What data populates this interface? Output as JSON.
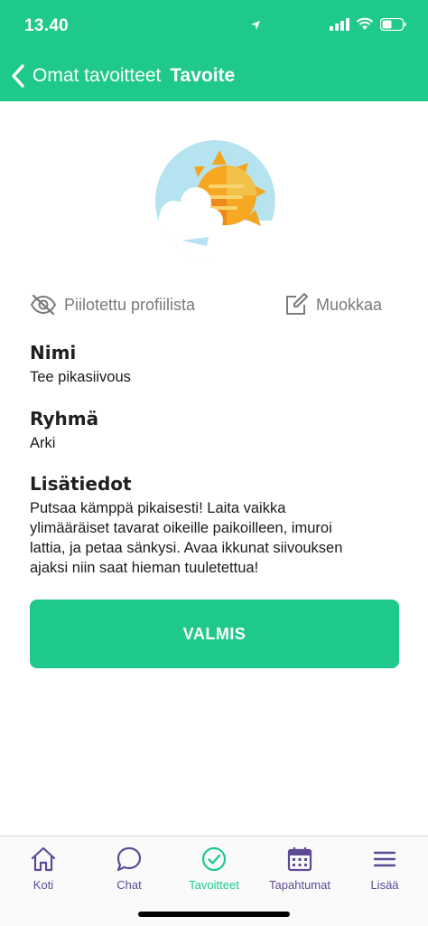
{
  "status": {
    "time": "13.40"
  },
  "nav": {
    "back_label": "Omat tavoitteet",
    "title": "Tavoite"
  },
  "actions": {
    "hidden_label": "Piilotettu profiilista",
    "edit_label": "Muokkaa"
  },
  "fields": {
    "name": {
      "label": "Nimi",
      "value": "Tee pikasiivous"
    },
    "group": {
      "label": "Ryhmä",
      "value": "Arki"
    },
    "details": {
      "label": "Lisätiedot",
      "lines": [
        "Putsaa kämppä pikaisesti! Laita vaikka",
        "ylimääräiset tavarat oikeille paikoilleen, imuroi",
        "lattia, ja petaa sänkysi. Avaa ikkunat siivouksen",
        "ajaksi niin saat hieman tuuletettua!"
      ]
    }
  },
  "done_button": {
    "label": "VALMIS"
  },
  "tabs": [
    {
      "label": "Koti",
      "icon": "home-icon"
    },
    {
      "label": "Chat",
      "icon": "chat-icon"
    },
    {
      "label": "Tavoitteet",
      "icon": "check-circle-icon",
      "active": true
    },
    {
      "label": "Tapahtumat",
      "icon": "calendar-icon"
    },
    {
      "label": "Lisää",
      "icon": "menu-icon"
    }
  ],
  "colors": {
    "accent": "#1ec98b",
    "tab_inactive": "#5d4a94",
    "sun": "#f7a823",
    "sky": "#a8dcef"
  }
}
